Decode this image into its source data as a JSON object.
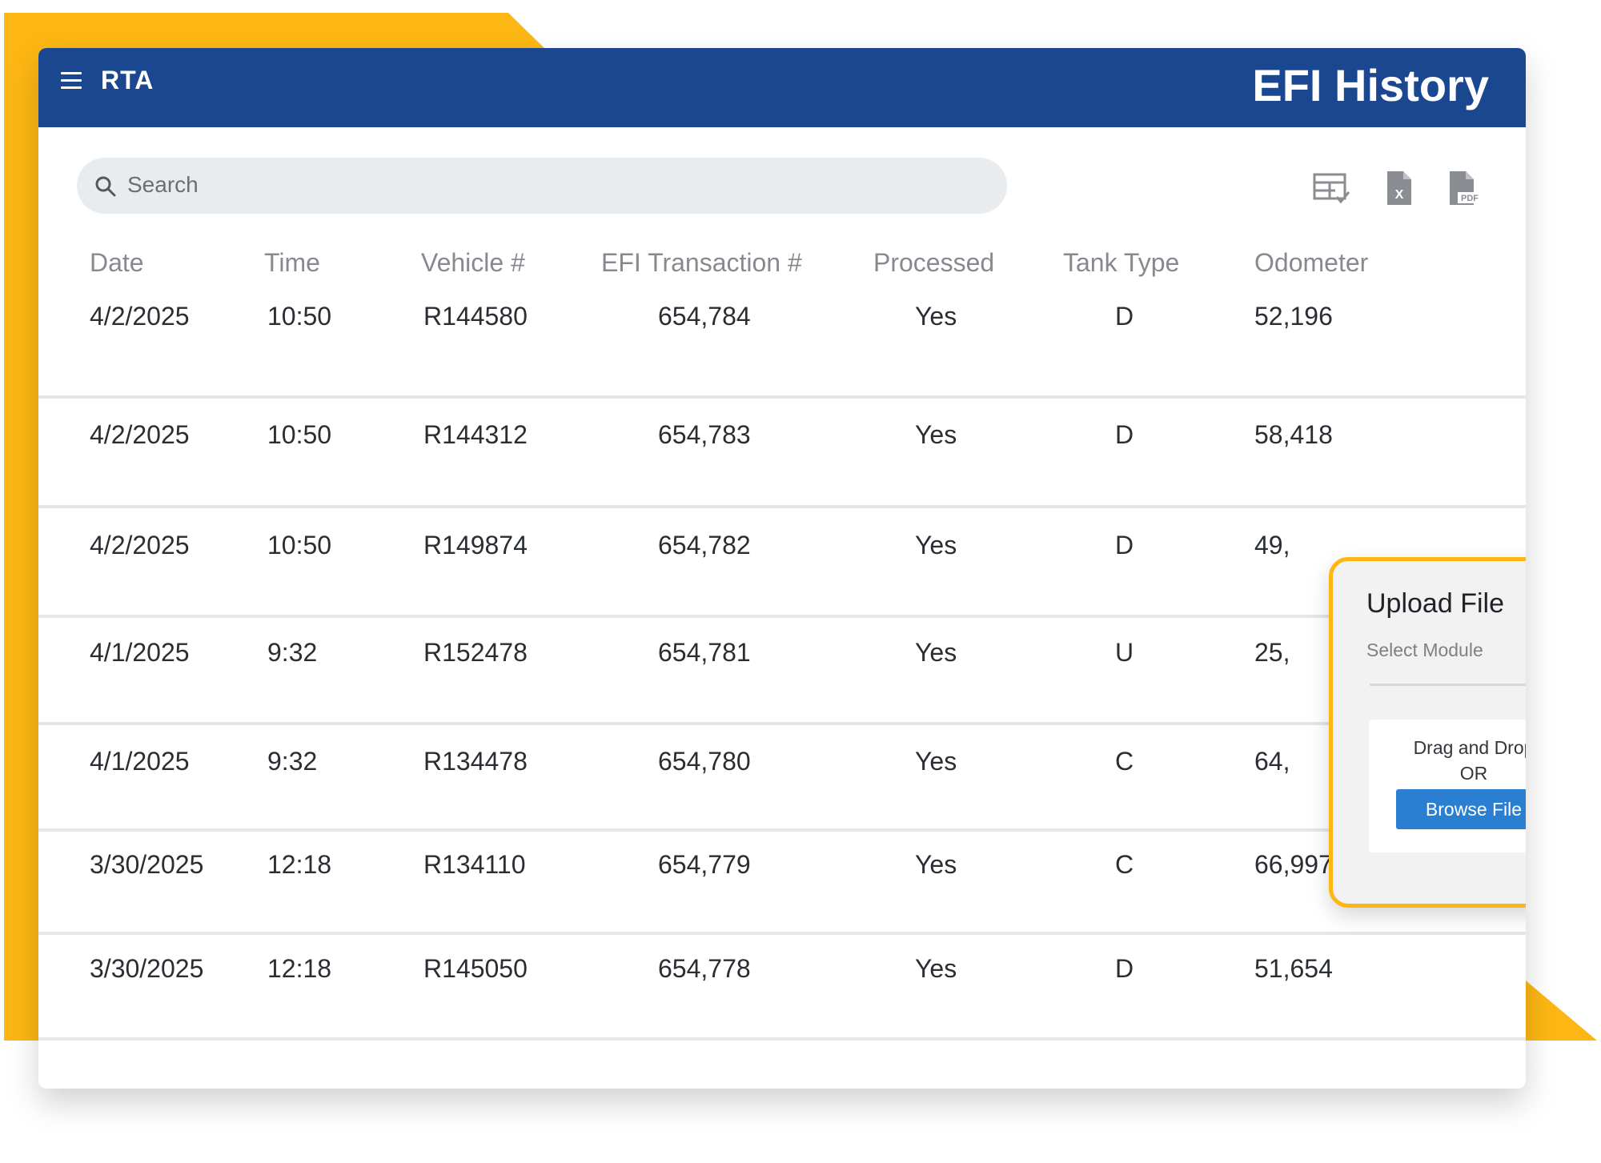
{
  "header": {
    "logo": "RTA",
    "title": "EFI History"
  },
  "search": {
    "placeholder": "Search"
  },
  "toolbar": {
    "icons": [
      "grid-export-icon",
      "excel-file-icon",
      "pdf-file-icon"
    ],
    "excel_label": "X",
    "pdf_label": "PDF"
  },
  "table": {
    "columns": [
      "Date",
      "Time",
      "Vehicle #",
      "EFI Transaction #",
      "Processed",
      "Tank Type",
      "Odometer"
    ],
    "rows": [
      [
        "4/2/2025",
        "10:50",
        "R144580",
        "654,784",
        "Yes",
        "D",
        "52,196"
      ],
      [
        "4/2/2025",
        "10:50",
        "R144312",
        "654,783",
        "Yes",
        "D",
        "58,418"
      ],
      [
        "4/2/2025",
        "10:50",
        "R149874",
        "654,782",
        "Yes",
        "D",
        "49,"
      ],
      [
        "4/1/2025",
        "9:32",
        "R152478",
        "654,781",
        "Yes",
        "U",
        "25,"
      ],
      [
        "4/1/2025",
        "9:32",
        "R134478",
        "654,780",
        "Yes",
        "C",
        "64,"
      ],
      [
        "3/30/2025",
        "12:18",
        "R134110",
        "654,779",
        "Yes",
        "C",
        "66,997"
      ],
      [
        "3/30/2025",
        "12:18",
        "R145050",
        "654,778",
        "Yes",
        "D",
        "51,654"
      ]
    ]
  },
  "upload": {
    "title": "Upload File",
    "select_label": "Select Module",
    "drag_text": "Drag and Drop",
    "or_text": "OR",
    "browse_label": "Browse File"
  },
  "colors": {
    "header_blue": "#1A4790",
    "accent_yellow": "#FDB714",
    "button_blue": "#2B7FD2"
  }
}
